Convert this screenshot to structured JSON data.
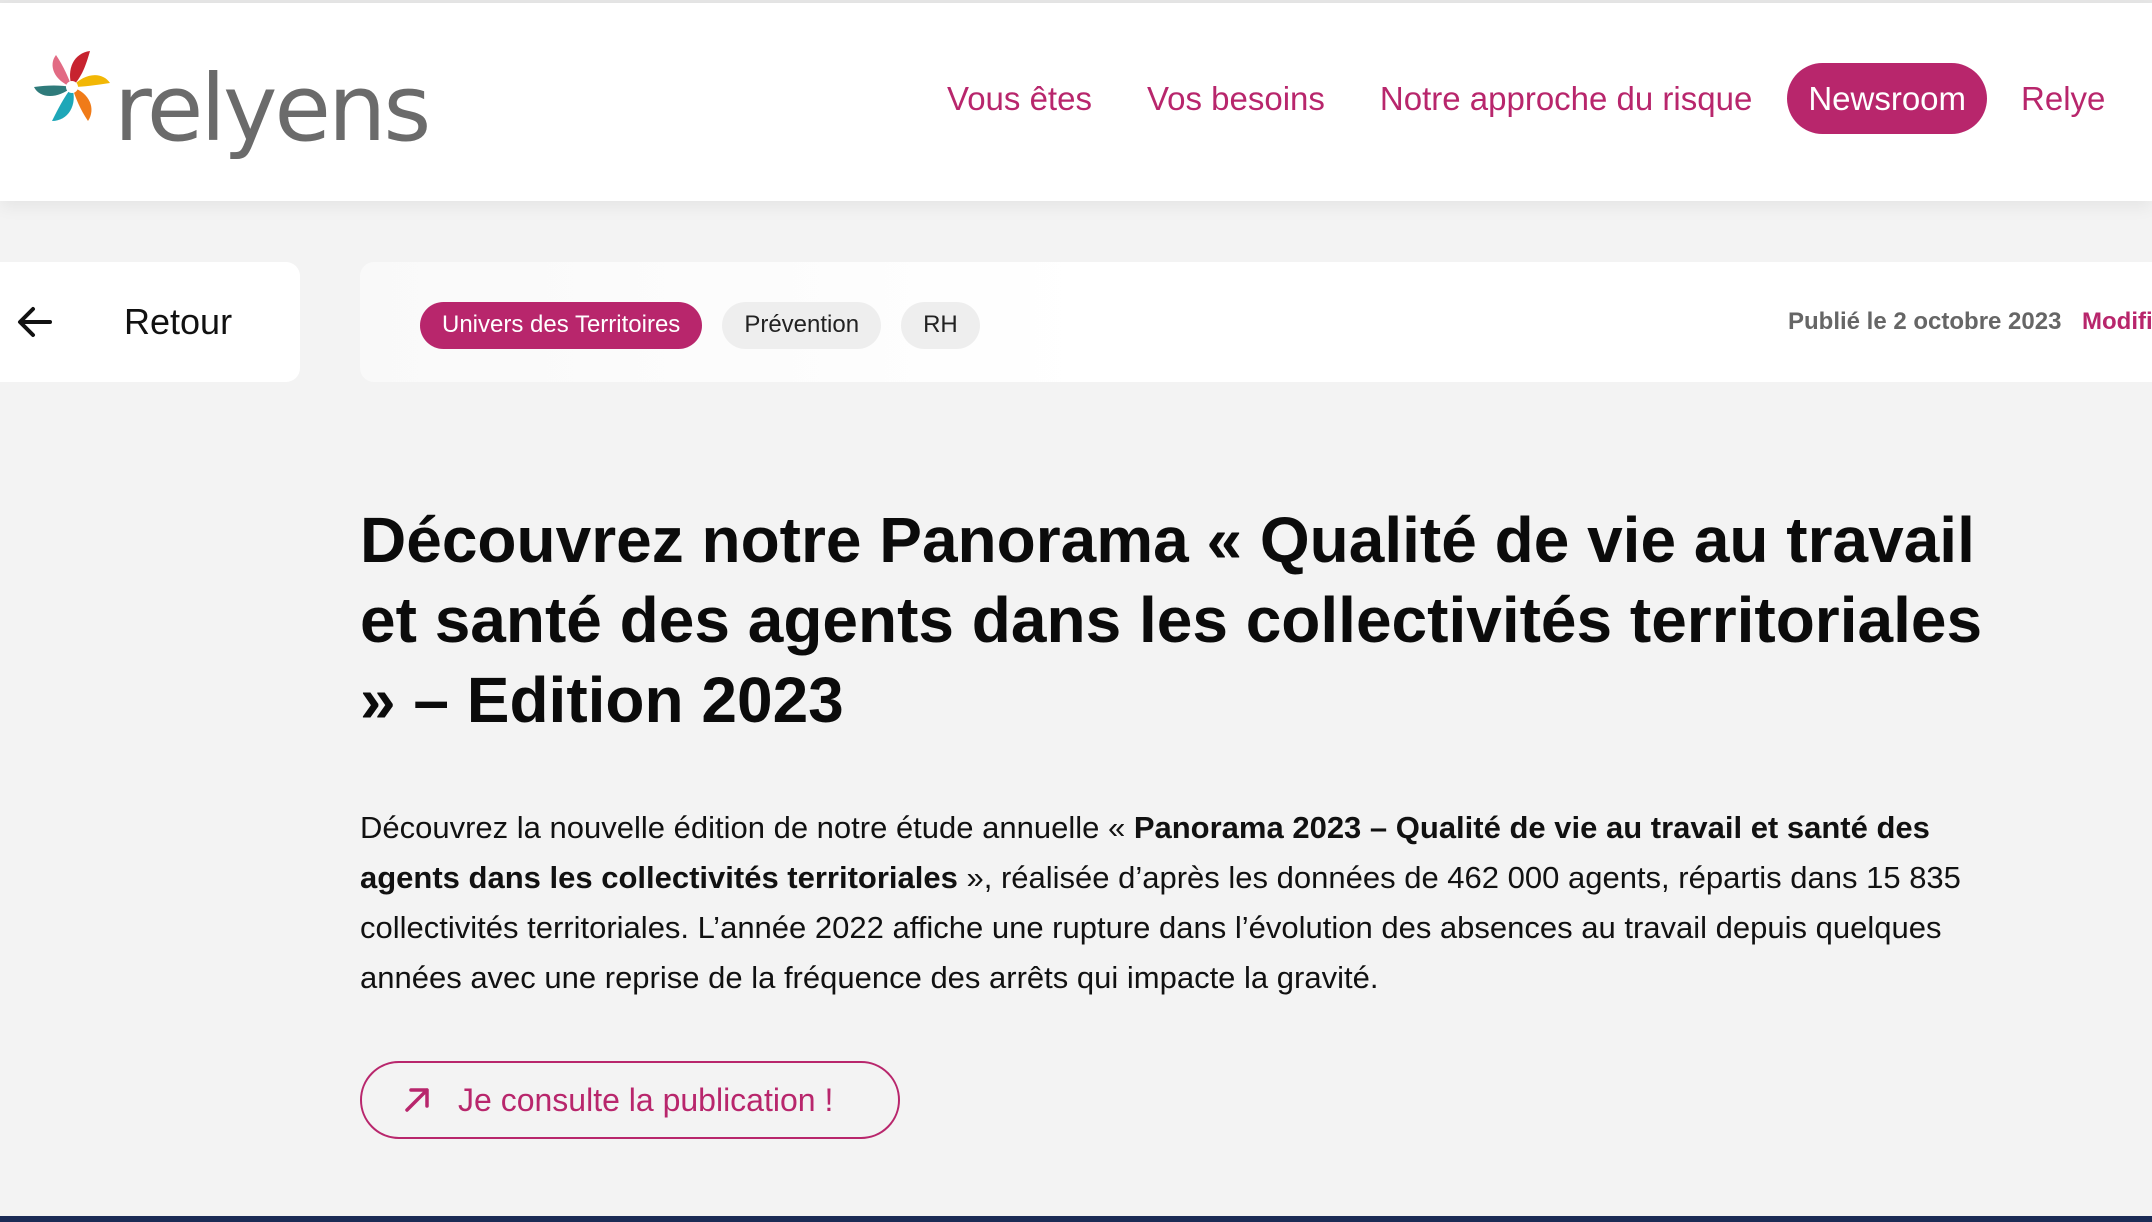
{
  "brand": {
    "name": "relyens",
    "accent_color": "#b8266c"
  },
  "nav": {
    "items": [
      "Vous êtes",
      "Vos besoins",
      "Notre approche du risque",
      "Newsroom",
      "Relye"
    ],
    "active": "Newsroom"
  },
  "back": {
    "label": "Retour",
    "icon": "arrow-left-icon"
  },
  "meta": {
    "tags": [
      "Univers des Territoires",
      "Prévention",
      "RH"
    ],
    "published": "Publié le 2 octobre 2023",
    "modified": "Modifi"
  },
  "article": {
    "title": "Découvrez notre Panorama « Qualité de vie au travail et santé des agents dans les collectivités territoriales » – Edition 2023",
    "intro_start": "Découvrez la nouvelle édition de notre étude annuelle « ",
    "intro_bold": "Panorama 2023 – Qualité de vie au travail et santé des agents dans les collectivités territoriales",
    "intro_end": " », réalisée d’après les données de 462 000 agents, répartis dans 15 835 collectivités territoriales. L’année 2022 affiche une rupture dans l’évolution des absences au travail depuis quelques années avec une reprise de la fréquence des arrêts qui impacte la gravité.",
    "cta_label": "Je consulte la publication !",
    "cta_icon": "arrow-up-right-icon"
  }
}
